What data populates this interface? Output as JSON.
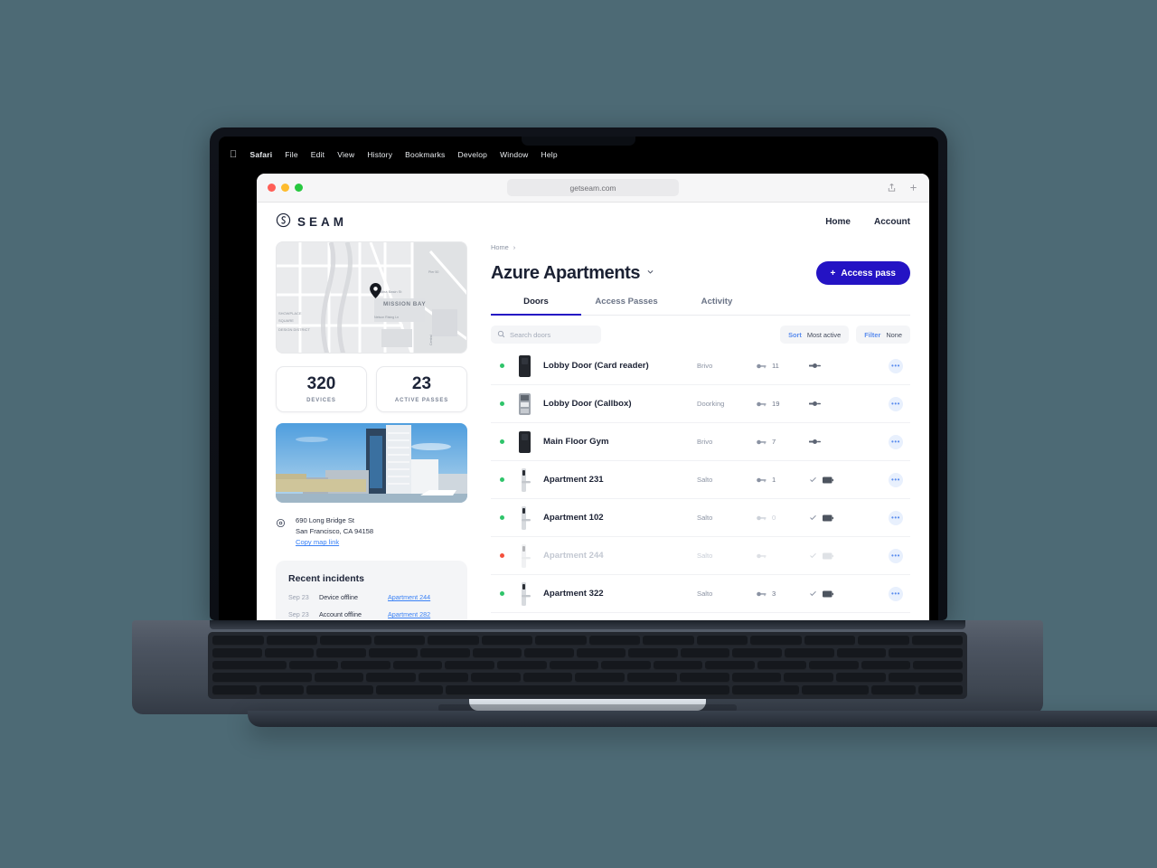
{
  "desktop": {
    "background_color": "#4d6a75"
  },
  "menubar": {
    "apple_icon": "apple-icon",
    "items": [
      "Safari",
      "File",
      "Edit",
      "View",
      "History",
      "Bookmarks",
      "Develop",
      "Window",
      "Help"
    ]
  },
  "browser": {
    "url": "getseam.com",
    "share_icon": "share-icon",
    "new_tab_icon": "plus-icon"
  },
  "app": {
    "logo_text": "SEAM",
    "logo_icon": "seam-logo-icon",
    "nav": [
      {
        "label": "Home"
      },
      {
        "label": "Account"
      }
    ],
    "breadcrumb": {
      "label": "Home",
      "separator": "›"
    },
    "title": "Azure Apartments",
    "title_caret_icon": "chevron-down-icon",
    "access_pass_button": {
      "label": "Access pass",
      "icon": "plus-icon",
      "color": "#2413c4"
    },
    "tabs": [
      {
        "label": "Doors",
        "active": true
      },
      {
        "label": "Access Passes",
        "active": false
      },
      {
        "label": "Activity",
        "active": false
      }
    ],
    "search": {
      "placeholder": "Search doors",
      "value": "",
      "icon": "search-icon"
    },
    "sort": {
      "label": "Sort",
      "value": "Most active"
    },
    "filter": {
      "label": "Filter",
      "value": "None"
    },
    "doors": [
      {
        "status": "online",
        "thumb": "reader-black",
        "name": "Lobby Door (Card reader)",
        "brand": "Brivo",
        "keys": "11",
        "power": "wired",
        "menu": "•••"
      },
      {
        "status": "online",
        "thumb": "callbox",
        "name": "Lobby Door (Callbox)",
        "brand": "Doorking",
        "keys": "19",
        "power": "wired",
        "menu": "•••"
      },
      {
        "status": "online",
        "thumb": "reader-black",
        "name": "Main Floor Gym",
        "brand": "Brivo",
        "keys": "7",
        "power": "wired",
        "menu": "•••"
      },
      {
        "status": "online",
        "thumb": "lock-handle",
        "name": "Apartment 231",
        "brand": "Salto",
        "keys": "1",
        "power": "battery",
        "menu": "•••"
      },
      {
        "status": "online",
        "thumb": "lock-handle",
        "name": "Apartment 102",
        "brand": "Salto",
        "keys": "0",
        "power": "battery",
        "menu": "•••"
      },
      {
        "status": "offline",
        "thumb": "lock-handle",
        "name": "Apartment 244",
        "brand": "Salto",
        "keys": "",
        "power": "battery",
        "menu": "•••"
      },
      {
        "status": "online",
        "thumb": "lock-handle",
        "name": "Apartment 322",
        "brand": "Salto",
        "keys": "3",
        "power": "battery",
        "menu": "•••"
      }
    ],
    "map": {
      "label": "MISSION BAY",
      "labels": [
        "SHOWPLACE SQUARE",
        "DESIGN DISTRICT",
        "MISSION BAY"
      ],
      "pin_icon": "map-pin-icon"
    },
    "stats": [
      {
        "value": "320",
        "label": "DEVICES"
      },
      {
        "value": "23",
        "label": "ACTIVE PASSES"
      }
    ],
    "address": {
      "pin_icon": "location-pin-icon",
      "line1": "690 Long Bridge St",
      "line2": "San Francisco, CA  94158",
      "link": "Copy map link"
    },
    "incidents": {
      "title": "Recent incidents",
      "rows": [
        {
          "date": "Sep 23",
          "desc": "Device offline",
          "unit": "Apartment 244"
        },
        {
          "date": "Sep 23",
          "desc": "Account offline",
          "unit": "Apartment 282"
        }
      ]
    }
  }
}
